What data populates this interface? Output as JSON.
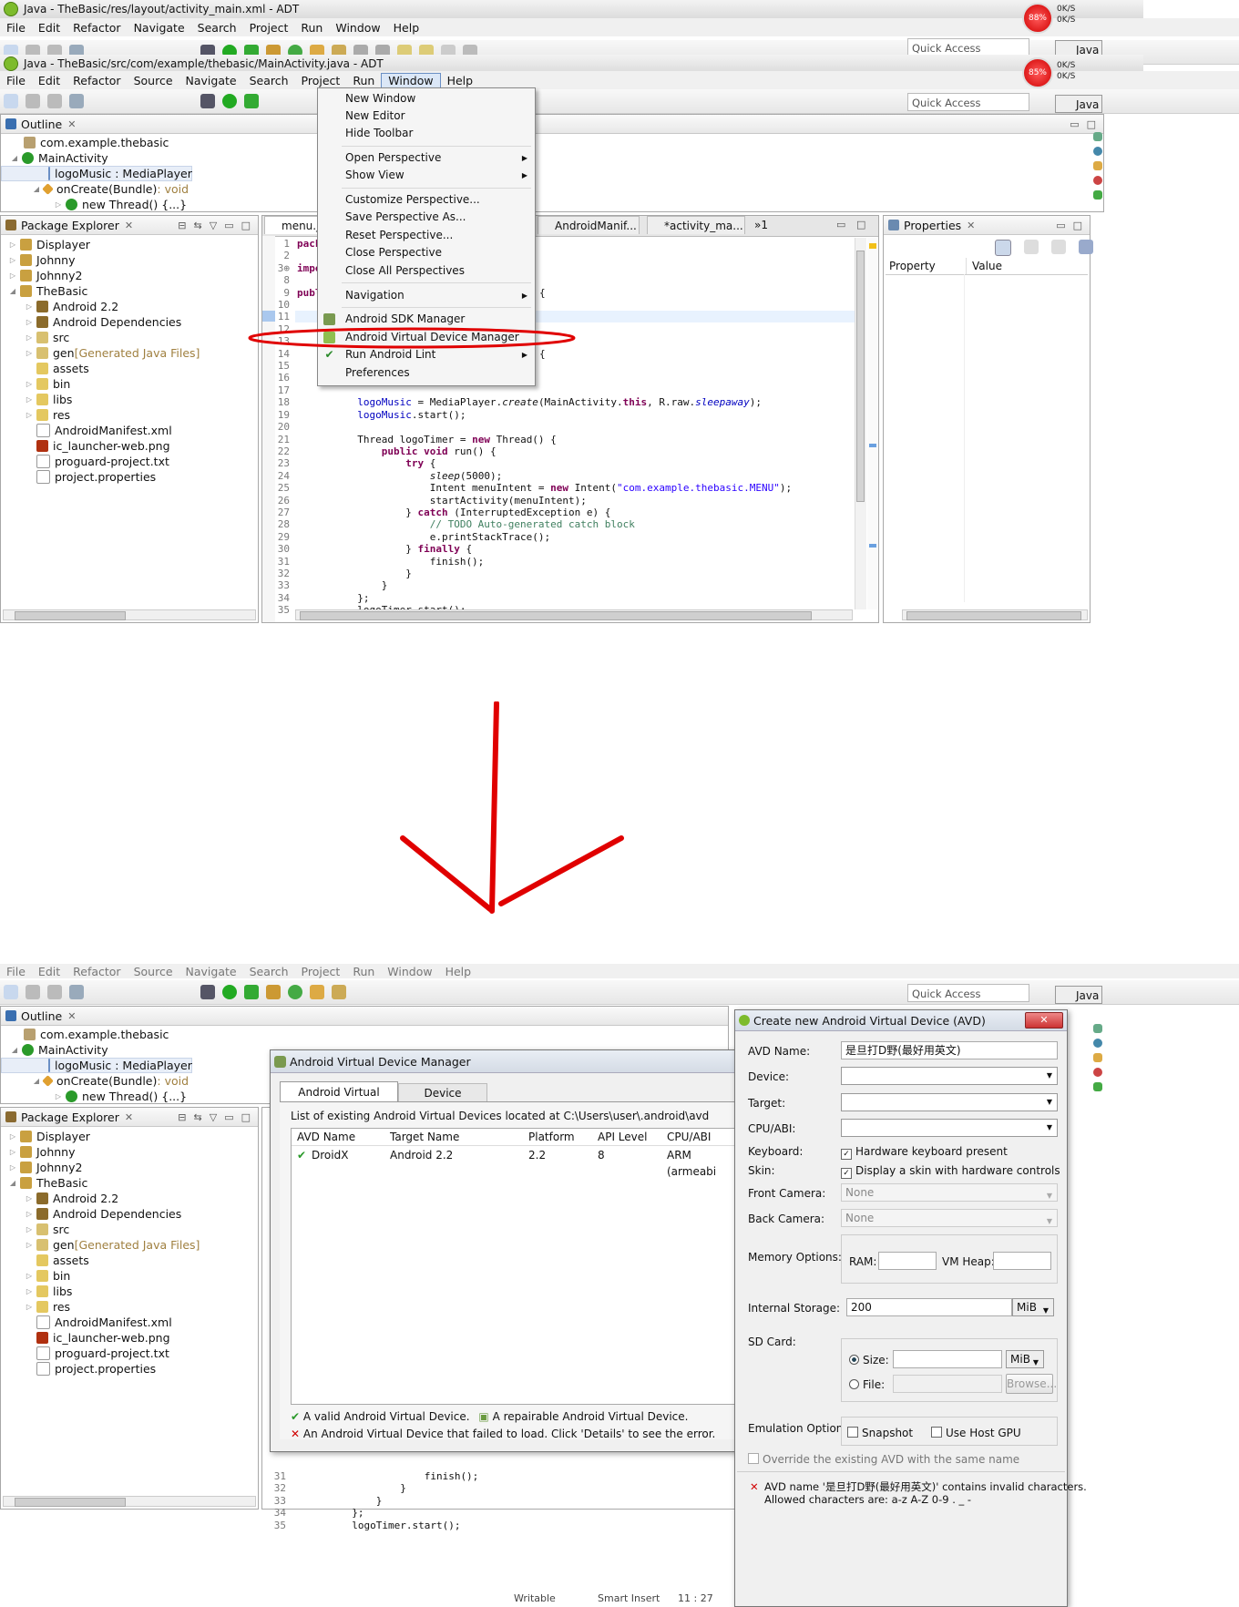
{
  "top": {
    "back_window_title": "Java - TheBasic/res/layout/activity_main.xml - ADT",
    "window_title": "Java - TheBasic/src/com/example/thebasic/MainActivity.java - ADT",
    "menu_back": [
      "File",
      "Edit",
      "Refactor",
      "Navigate",
      "Search",
      "Project",
      "Run",
      "Window",
      "Help"
    ],
    "menu": [
      "File",
      "Edit",
      "Refactor",
      "Source",
      "Navigate",
      "Search",
      "Project",
      "Run",
      "Window",
      "Help"
    ],
    "quick_access": "Quick Access",
    "perspective": "Java",
    "cpu1": "88%",
    "cpu2": "85%",
    "kbs_up": "0K/S",
    "kbs_down": "0K/S"
  },
  "outline": {
    "title": "Outline",
    "items": [
      "com.example.thebasic",
      "MainActivity",
      "logoMusic : MediaPlayer",
      "onCreate(Bundle)",
      " : void",
      "new Thread() {...}"
    ]
  },
  "package_explorer": {
    "title": "Package Explorer",
    "items": [
      "Displayer",
      "Johnny",
      "Johnny2",
      "TheBasic",
      "Android 2.2",
      "Android Dependencies",
      "src",
      "gen",
      " [Generated Java Files]",
      "assets",
      "bin",
      "libs",
      "res",
      "AndroidManifest.xml",
      "ic_launcher-web.png",
      "proguard-project.txt",
      "project.properties"
    ]
  },
  "editor": {
    "tabs": [
      "menu.ja",
      "AndroidManif...",
      "*activity_ma...",
      "»1"
    ],
    "line_numbers": [
      "1",
      "2",
      "3⊕",
      "8",
      "9",
      "10",
      "11",
      "12",
      "13",
      "14",
      "15",
      "16",
      "17",
      "18",
      "19",
      "20",
      "21",
      "22",
      "23",
      "24",
      "25",
      "26",
      "27",
      "28",
      "29",
      "30",
      "31",
      "32",
      "33",
      "34",
      "35"
    ],
    "code": {
      "l1": "pack",
      "l3": "impo",
      "l9": "publ",
      "l18a": "logoMusic",
      "l18b": " = MediaPlayer.",
      "l18c": "create",
      "l18d": "(MainActivity.",
      "l18e": "this",
      "l18f": ", R.raw.",
      "l18g": "sleepaway",
      "l18h": ");",
      "l19a": "logoMusic",
      "l19b": ".start();",
      "l21a": "Thread logoTimer = ",
      "l21b": "new",
      "l21c": " Thread() {",
      "l22a": "public",
      "l22b": " ",
      "l22c": "void",
      "l22d": " run() {",
      "l23": "try",
      "l23b": " {",
      "l24a": "sleep",
      "l24b": "(5000);",
      "l25a": "Intent menuIntent = ",
      "l25b": "new",
      "l25c": " Intent(",
      "l25d": "\"com.example.thebasic.MENU\"",
      "l25e": ");",
      "l26": "startActivity(menuIntent);",
      "l27a": "} ",
      "l27b": "catch",
      "l27c": " (InterruptedException e) {",
      "l28": "// TODO Auto-generated catch block",
      "l29": "e.printStackTrace();",
      "l30a": "} ",
      "l30b": "finally",
      "l30c": " {",
      "l31": "finish();",
      "l32": "}",
      "l33": "}",
      "l34": "};",
      "l35": "logoTimer.start();",
      "brace1": "{",
      "brace2": "{"
    }
  },
  "properties": {
    "title": "Properties",
    "col_property": "Property",
    "col_value": "Value"
  },
  "window_menu": {
    "items": [
      "New Window",
      "New Editor",
      "Hide Toolbar",
      "Open Perspective",
      "Show View",
      "Customize Perspective...",
      "Save Perspective As...",
      "Reset Perspective...",
      "Close Perspective",
      "Close All Perspectives",
      "Navigation",
      "Android SDK Manager",
      "Android Virtual Device Manager",
      "Run Android Lint",
      "Preferences"
    ]
  },
  "avd_manager": {
    "title": "Android Virtual Device Manager",
    "tabs": [
      "Android Virtual Devices",
      "Device Definitions"
    ],
    "location": "List of existing Android Virtual Devices located at C:\\Users\\user\\.android\\avd",
    "columns": [
      "AVD Name",
      "Target Name",
      "Platform",
      "API Level",
      "CPU/ABI"
    ],
    "rows": [
      [
        "DroidX",
        "Android 2.2",
        "2.2",
        "8",
        "ARM (armeabi"
      ]
    ],
    "legend_valid": "A valid Android Virtual Device.",
    "legend_repairable": "A repairable Android Virtual Device.",
    "legend_failed": "An Android Virtual Device that failed to load. Click 'Details' to see the error."
  },
  "create_avd": {
    "title": "Create new Android Virtual Device (AVD)",
    "labels": {
      "avd_name": "AVD Name:",
      "device": "Device:",
      "target": "Target:",
      "cpu": "CPU/ABI:",
      "keyboard": "Keyboard:",
      "skin": "Skin:",
      "front_camera": "Front Camera:",
      "back_camera": "Back Camera:",
      "memory": "Memory Options:",
      "ram": "RAM:",
      "vm_heap": "VM Heap:",
      "internal_storage": "Internal Storage:",
      "sd_card": "SD Card:",
      "size": "Size:",
      "file": "File:",
      "emulation": "Emulation Options:"
    },
    "avd_name_value": "是旦打D野(最好用英文)",
    "keyboard_value": "Hardware keyboard present",
    "skin_value": "Display a skin with hardware controls",
    "front_camera_value": "None",
    "back_camera_value": "None",
    "internal_storage_value": "200",
    "internal_storage_unit": "MiB",
    "sd_size_unit": "MiB",
    "browse": "Browse...",
    "snapshot": "Snapshot",
    "use_host_gpu": "Use Host GPU",
    "override": "Override the existing AVD with the same name",
    "error_line1": "AVD name '是旦打D野(最好用英文)' contains invalid characters.",
    "error_line2": "Allowed characters are: a-z A-Z 0-9 . _ -"
  },
  "bottom_code": {
    "line_numbers": [
      "31",
      "32",
      "33",
      "34",
      "35"
    ],
    "l31": "finish();",
    "l32": "}",
    "l33": "}",
    "l34": "};",
    "l35": "logoTimer.start();"
  },
  "status_bar": {
    "writable": "Writable",
    "insert": "Smart Insert",
    "position": "11 : 27"
  },
  "colors": {
    "annotation_red": "#e00000",
    "accent_blue": "#3a6fb0"
  }
}
